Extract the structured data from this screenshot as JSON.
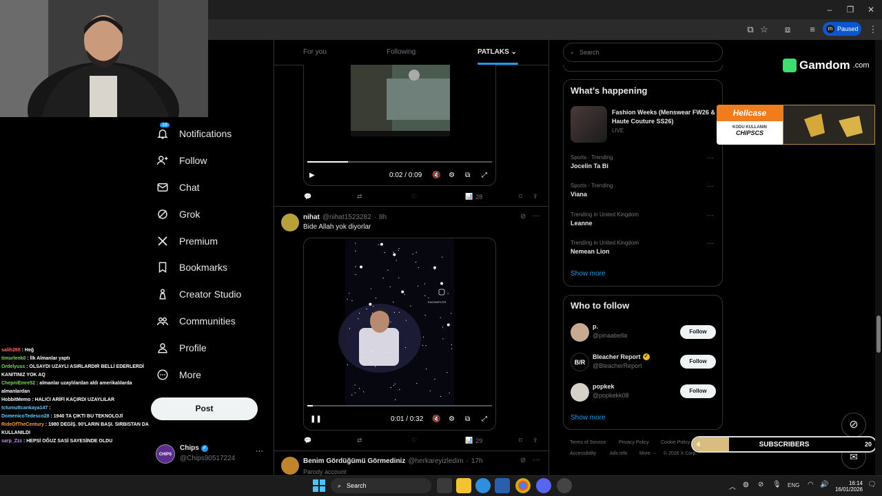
{
  "browser": {
    "profile_status": "Paused",
    "profile_initial": "m"
  },
  "nav": {
    "notification_count": "19",
    "items": [
      {
        "label": "Notifications"
      },
      {
        "label": "Follow"
      },
      {
        "label": "Chat"
      },
      {
        "label": "Grok"
      },
      {
        "label": "Premium"
      },
      {
        "label": "Bookmarks"
      },
      {
        "label": "Creator Studio"
      },
      {
        "label": "Communities"
      },
      {
        "label": "Profile"
      },
      {
        "label": "More"
      }
    ],
    "post_label": "Post",
    "account": {
      "name": "Chips",
      "handle": "@Chips90517224"
    }
  },
  "tabs": [
    "For you",
    "Following",
    "PATLAKS"
  ],
  "feed": {
    "post1": {
      "time": "0:02 / 0:09",
      "progress": 0.22,
      "views": "28"
    },
    "post2": {
      "name": "nihat",
      "handle": "@nihat1523282",
      "age": "8h",
      "text": "Bide Allah yok diyorlar",
      "time": "0:01 / 0:32",
      "progress": 0.03,
      "views": "29",
      "watermark": "ENGINSPUTR"
    },
    "post3": {
      "name": "Benim Gördüğümü Görmediniz",
      "handle": "@herkareyizledim",
      "age": "17h",
      "sub": "Parody account"
    }
  },
  "right": {
    "search_placeholder": "Search",
    "happening": {
      "title": "What’s happening",
      "featured": {
        "title": "Fashion Weeks (Menswear FW26 & Haute Couture SS26)",
        "status": "LIVE"
      },
      "trends": [
        {
          "category": "Sports · Trending",
          "name": "Jocelin Ta Bi"
        },
        {
          "category": "Sports · Trending",
          "name": "Viana"
        },
        {
          "category": "Trending in United Kingdom",
          "name": "Leanne"
        },
        {
          "category": "Trending in United Kingdom",
          "name": "Nemean Lion"
        }
      ],
      "show_more": "Show more"
    },
    "who_to_follow": {
      "title": "Who to follow",
      "accounts": [
        {
          "name": "p.",
          "handle": "@pinaabella",
          "button": "Follow"
        },
        {
          "name": "Bleacher Report",
          "handle": "@BleacherReport",
          "button": "Follow"
        },
        {
          "name": "popkek",
          "handle": "@popkekk08",
          "button": "Follow"
        }
      ],
      "show_more": "Show more"
    },
    "footer": [
      "Terms of Service",
      "Privacy Policy",
      "Cookie Policy",
      "Accessibility",
      "Ads info",
      "More ···",
      "© 2026 X Corp."
    ]
  },
  "overlays": {
    "gamdom": "Gamdom",
    "gamdom_suffix": ".com",
    "hellcase": "Hellcase",
    "hellcase_line1": "KODU KULLANIN",
    "hellcase_code": "CHIPSCS",
    "subs_label": "SUBSCRIBERS",
    "subs_current": "4",
    "subs_goal": "20",
    "subs_progress": 0.2
  },
  "chat": [
    {
      "user": "salih265",
      "msg": ": Heğ",
      "color": "#ff6b6b"
    },
    {
      "user": "timurlenk0",
      "msg": ": İlk Almanlar yaptı",
      "color": "#7ed957"
    },
    {
      "user": "Ordelyuss",
      "msg": ": OLSAYDI UZAYLI ASIRLARDIR BELLİ EDERLERDİ KANITINIZ YOK AQ",
      "color": "#7ed957"
    },
    {
      "user": "ChepniEmre52",
      "msg": ": almanlar uzaylılardan aldı amerikalılarda almanlardan",
      "color": "#7ed957"
    },
    {
      "user": "HobbitMemo",
      "msg": ": HALICI ARİFİ KAÇIRDI UZAYLILAR",
      "color": "#fff"
    },
    {
      "user": "tctumuttcankaya147",
      "msg": ":",
      "color": "#62c9ff"
    },
    {
      "user": "DomenicoTedesco28",
      "msg": ": 1940 TA ÇIKTI BU TEKNOLOJİ",
      "color": "#62c9ff"
    },
    {
      "user": "RideOfTheCentury",
      "msg": ": 1980 DEGİŞ. 90'LARIN BAŞI. SIRBISTAN DA KULLANILDI",
      "color": "#ff9933"
    },
    {
      "user": "sarp_Zzz",
      "msg": ": HEPSİ OĞUZ SASİ SAYESİNDE OLDU",
      "color": "#c58cff"
    }
  ],
  "taskbar": {
    "search": "Search",
    "lang": "ENG",
    "time": "16:14",
    "date": "16/01/2026"
  },
  "colors": {
    "accent": "#1d9bf0",
    "bg": "#000000",
    "border": "#2f3336",
    "verified": "#1d9bf0"
  }
}
